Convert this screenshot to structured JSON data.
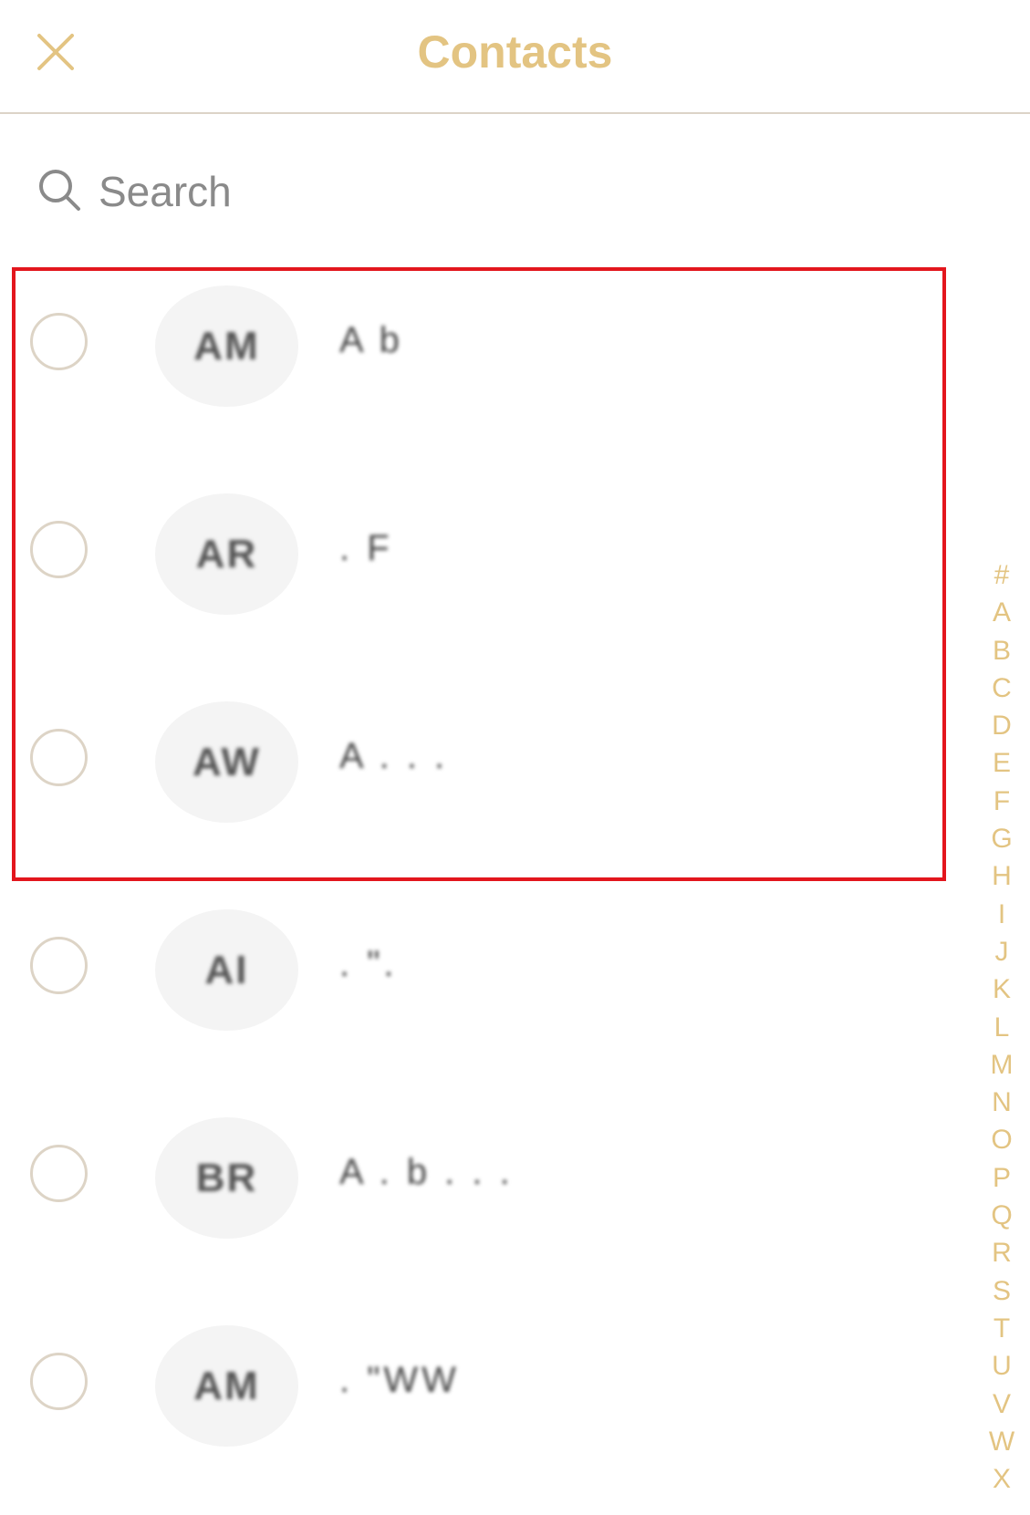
{
  "header": {
    "title": "Contacts"
  },
  "search": {
    "placeholder": "Search"
  },
  "contacts": [
    {
      "initials": "AM",
      "name": "A b"
    },
    {
      "initials": "AR",
      "name": ". F"
    },
    {
      "initials": "AW",
      "name": "A . . ."
    },
    {
      "initials": "AI",
      "name": ". \"."
    },
    {
      "initials": "BR",
      "name": "A . b . . ."
    },
    {
      "initials": "AM",
      "name": ". \"WW"
    }
  ],
  "alphabet_index": [
    "#",
    "A",
    "B",
    "C",
    "D",
    "E",
    "F",
    "G",
    "H",
    "I",
    "J",
    "K",
    "L",
    "M",
    "N",
    "O",
    "P",
    "Q",
    "R",
    "S",
    "T",
    "U",
    "V",
    "W",
    "X"
  ],
  "colors": {
    "accent": "#e3c482",
    "highlight_border": "#e3161d",
    "radio_border": "#ddd4c6",
    "avatar_bg": "#f4f4f4"
  }
}
